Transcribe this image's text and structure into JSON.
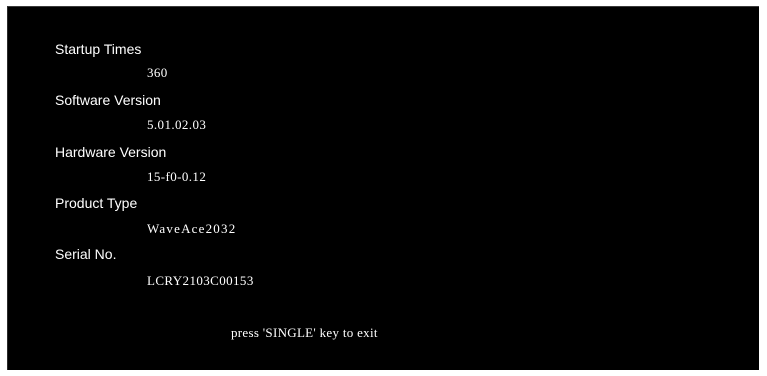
{
  "info": {
    "startup_times": {
      "label": "Startup Times",
      "value": "360"
    },
    "software_version": {
      "label": "Software Version",
      "value": "5.01.02.03"
    },
    "hardware_version": {
      "label": "Hardware Version",
      "value": "15-f0-0.12"
    },
    "product_type": {
      "label": "Product Type",
      "value": "WaveAce2032"
    },
    "serial_no": {
      "label": "Serial No.",
      "value": "LCRY2103C00153"
    }
  },
  "footer": {
    "exit_hint": "press 'SINGLE' key to exit"
  },
  "colors": {
    "background": "#000000",
    "text": "#ffffff"
  }
}
